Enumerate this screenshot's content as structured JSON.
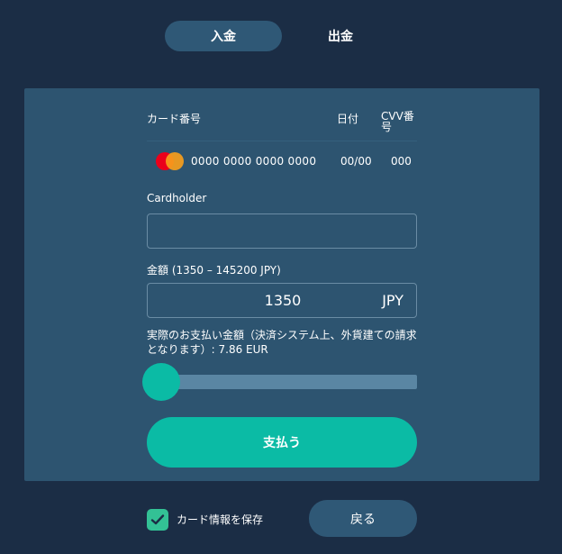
{
  "tabs": {
    "deposit": "入金",
    "withdraw": "出金"
  },
  "card": {
    "header_number": "カード番号",
    "header_date": "日付",
    "header_cvv": "CVV番号",
    "number": "0000 0000 0000 0000",
    "date": "00/00",
    "cvv": "000",
    "brand_icon": "mastercard-icon"
  },
  "cardholder": {
    "label": "Cardholder",
    "value": "",
    "placeholder": ""
  },
  "amount": {
    "label": "金額 (1350 – 145200 JPY)",
    "value": "1350",
    "currency": "JPY",
    "actual_text": "実際のお支払い金額（決済システム上、外貨建ての請求となります）: 7.86 EUR"
  },
  "slider": {
    "min": 1350,
    "max": 145200,
    "value": 1350,
    "fraction": 0.0
  },
  "pay_button": "支払う",
  "save": {
    "label": "カード情報を保存",
    "checked": true
  },
  "back_button": "戻る",
  "colors": {
    "background": "#1b2d45",
    "panel": "#2d5470",
    "accent": "#0bbba5",
    "tab_active": "#2f5876",
    "check": "#33c195",
    "mc_red": "#eb001b",
    "mc_orange": "#f79e1b"
  }
}
